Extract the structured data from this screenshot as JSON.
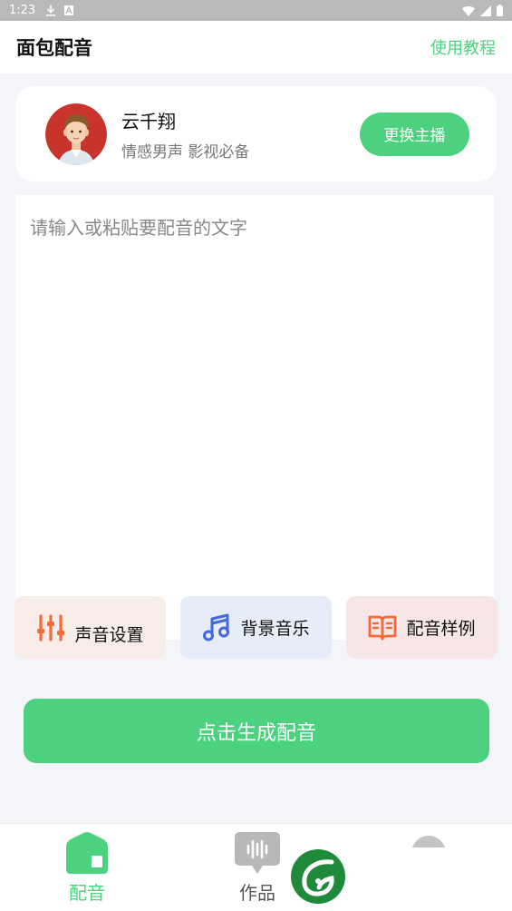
{
  "status_bar": {
    "time": "1:23",
    "icons": [
      "download-icon",
      "a-icon",
      "wifi-icon",
      "signal-icon",
      "battery-icon"
    ]
  },
  "header": {
    "title": "面包配音",
    "tutorial_label": "使用教程"
  },
  "host": {
    "name": "云千翔",
    "description": "情感男声 影视必备",
    "change_label": "更换主播"
  },
  "editor": {
    "placeholder": "请输入或粘贴要配音的文字",
    "value": ""
  },
  "tools": [
    {
      "label": "声音设置",
      "icon": "equalizer-icon"
    },
    {
      "label": "背景音乐",
      "icon": "music-note-icon"
    },
    {
      "label": "配音样例",
      "icon": "book-icon"
    }
  ],
  "generate_label": "点击生成配音",
  "bottom_nav": {
    "items": [
      {
        "label": "配音",
        "icon": "home-icon"
      },
      {
        "label": "作品",
        "icon": "waveform-icon"
      }
    ],
    "active": "配音"
  },
  "colors": {
    "accent": "#4cd27f",
    "voice_bg": "#f7ece7",
    "music_bg": "#e6ecf8",
    "sample_bg": "#f7e6e8",
    "voice_icon": "#f36b3a",
    "music_icon": "#4169e1",
    "sample_icon": "#f36b3a"
  }
}
